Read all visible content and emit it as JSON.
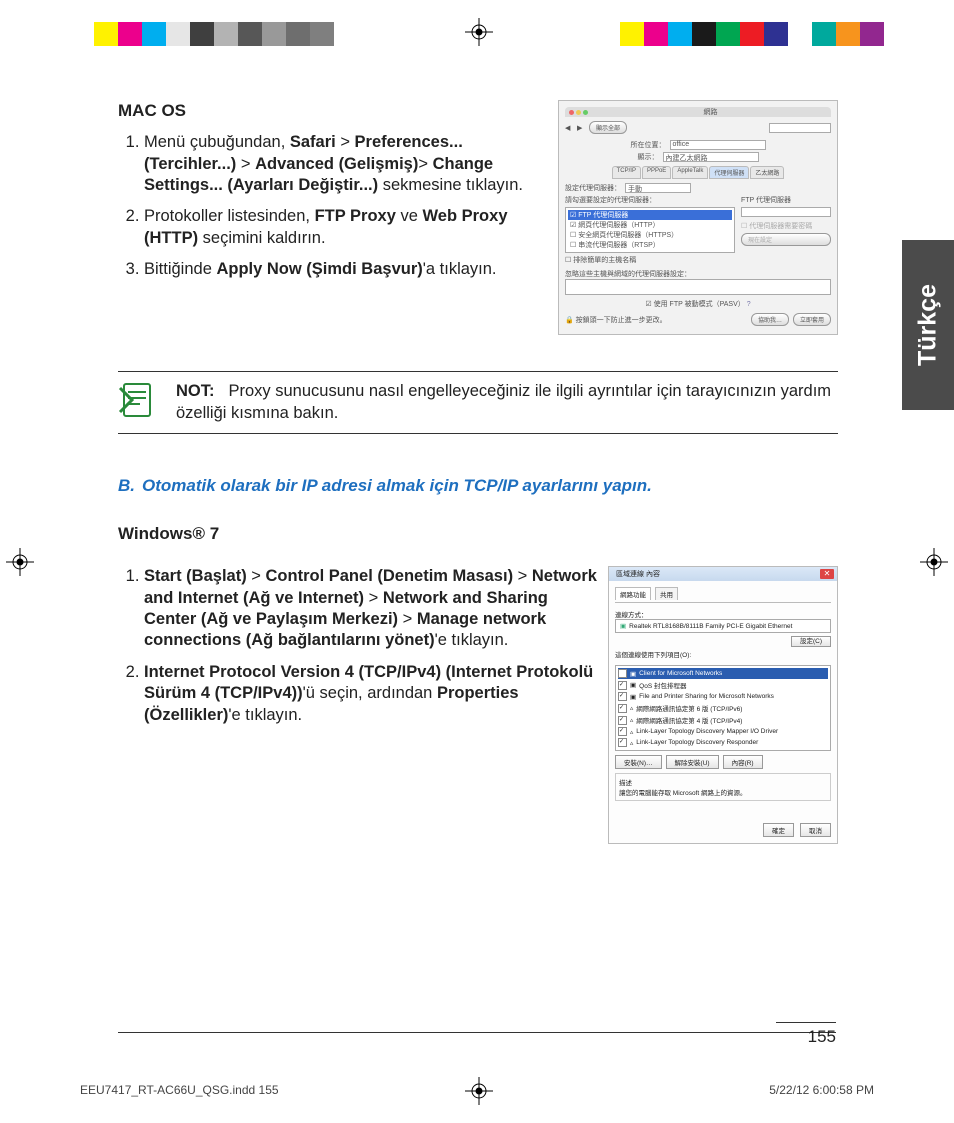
{
  "sidetab": "Türkçe",
  "macos": {
    "heading": "MAC OS",
    "steps": [
      {
        "pre": "Menü çubuğundan, ",
        "b1": "Safari",
        "gt1": " > ",
        "b2": "Preferences... (Tercihler...)",
        "gt2": " > ",
        "b3": "Advanced (Gelişmiş)",
        "gt3": "> ",
        "b4": "Change Settings... (Ayarları Değiştir...)",
        "post": " sekmesine tıklayın."
      },
      {
        "pre": "Protokoller listesinden, ",
        "b1": "FTP Proxy",
        "mid": " ve ",
        "b2": "Web Proxy (HTTP)",
        "post": " seçimini kaldırın."
      },
      {
        "pre": "Bittiğinde ",
        "b1": "Apply Now (Şimdi Başvur)",
        "post": "'a tıklayın."
      }
    ]
  },
  "note": {
    "label": "NOT:",
    "text": "Proxy sunucusunu nasıl engelleyeceğiniz ile ilgili ayrıntılar için tarayıcınızın yardım özelliği kısmına bakın."
  },
  "sectionB": {
    "letter": "B.",
    "title": "Otomatik olarak bir IP adresi almak için TCP/IP ayarlarını yapın."
  },
  "win7": {
    "heading": "Windows® 7",
    "steps": [
      {
        "b1": "Start (Başlat)",
        "gt1": " > ",
        "b2": "Control Panel (Denetim Masası)",
        "gt2": " > ",
        "b3": "Network and Internet (Ağ ve Internet)",
        "gt3": " > ",
        "b4": "Network and Sharing Center (Ağ ve Paylaşım Merkezi)",
        "gt4": " > ",
        "b5": "Manage network connections (Ağ bağlantılarını yönet)",
        "post": "'e tıklayın."
      },
      {
        "b1": "Internet Protocol Version 4 (TCP/IPv4) (Internet Protokolü Sürüm 4 (TCP/IPv4))",
        "mid": "'ü seçin, ardından ",
        "b2": "Properties (Özellikler)",
        "post": "'e tıklayın."
      }
    ]
  },
  "pagenum": "155",
  "footer": {
    "left": "EEU7417_RT-AC66U_QSG.indd   155",
    "right": "5/22/12   6:00:58 PM"
  },
  "colorbar_left": [
    "#fff",
    "#fff200",
    "#ec008c",
    "#00aeef",
    "#e6e6e6",
    "#3f3f3f",
    "#b3b3b3",
    "#575757",
    "#999",
    "#6e6e6e",
    "#7f7f7f"
  ],
  "colorbar_right": [
    "#fff200",
    "#ec008c",
    "#00aeef",
    "#1a1a1a",
    "#00a651",
    "#ed1c24",
    "#2e3192",
    "#fff",
    "#00a99d",
    "#f7941d",
    "#92278f"
  ],
  "mac_dialog": {
    "loc_label": "所在位置：",
    "loc_val": "office",
    "show_label": "顯示：",
    "show_val": "內建乙太網路",
    "tabs": [
      "TCP/IP",
      "PPPoE",
      "AppleTalk",
      "代理伺服器",
      "乙太網路"
    ],
    "mode_label": "設定代理伺服器：",
    "mode_val": "手動",
    "left_head": "請勾選要設定的代理伺服器：",
    "right_head": "FTP 代理伺服器",
    "items": [
      "FTP 代理伺服器",
      "網頁代理伺服器（HTTP）",
      "安全網頁代理伺服器（HTTPS）",
      "串流代理伺服器（RTSP）"
    ],
    "excl": "排除簡單的主機名稱",
    "bypass": "忽略這些主機與網域的代理伺服器設定：",
    "pasv": "使用 FTP 被動模式（PASV）",
    "lock": "按鎖頭一下防止進一步更改。",
    "assist": "協助我…",
    "apply": "立即套用"
  },
  "win_dialog": {
    "title": "區域連線 內容",
    "tab1": "網路功能",
    "tab2": "共用",
    "connect": "連線方式：",
    "adapter": "Realtek RTL8168B/8111B Family PCI-E Gigabit Ethernet",
    "cfg": "設定(C)",
    "uses": "這個連線使用下列項目(O):",
    "items": [
      "Client for Microsoft Networks",
      "QoS 封包排程器",
      "File and Printer Sharing for Microsoft Networks",
      "網際網路通訊協定第 6 版 (TCP/IPv6)",
      "網際網路通訊協定第 4 版 (TCP/IPv4)",
      "Link-Layer Topology Discovery Mapper I/O Driver",
      "Link-Layer Topology Discovery Responder"
    ],
    "install": "安裝(N)…",
    "uninstall": "解除安裝(U)",
    "props": "內容(R)",
    "desc_h": "描述",
    "desc": "讓您的電腦能存取 Microsoft 網路上的資源。",
    "ok": "確定",
    "cancel": "取消"
  }
}
